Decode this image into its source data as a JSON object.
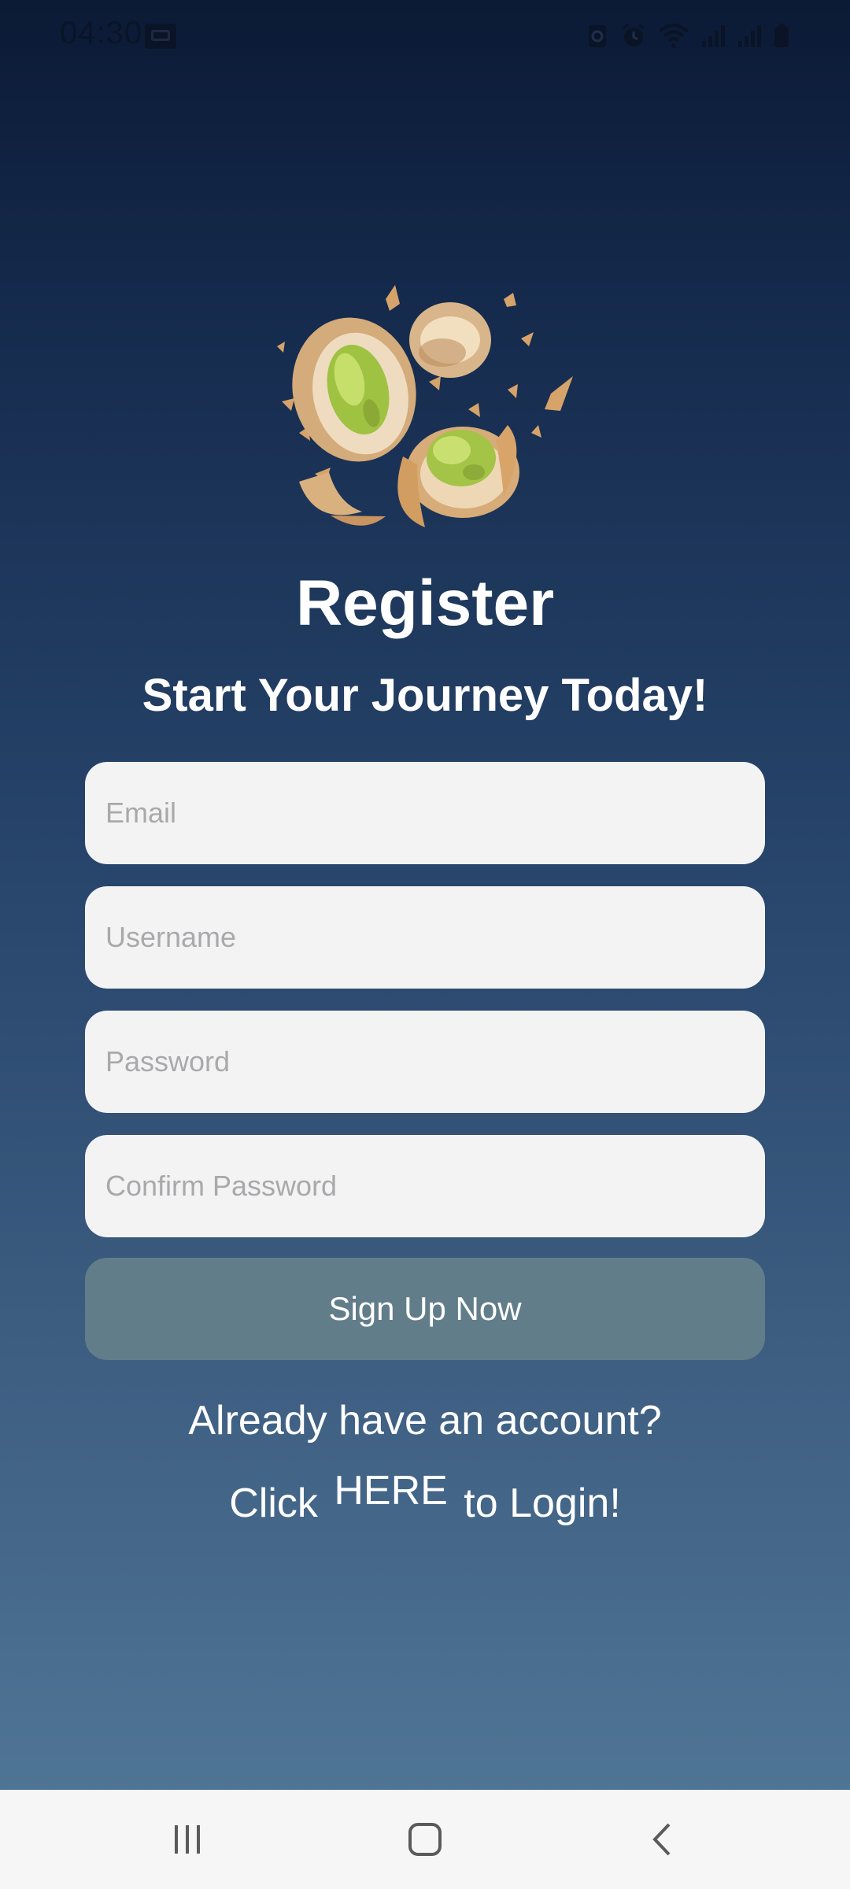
{
  "status_bar": {
    "time": "04:30"
  },
  "logo": {
    "icon": "pistachio-logo"
  },
  "title": "Register",
  "subtitle": "Start Your Journey Today!",
  "form": {
    "email_placeholder": "Email",
    "username_placeholder": "Username",
    "password_placeholder": "Password",
    "confirm_password_placeholder": "Confirm Password",
    "signup_label": "Sign Up Now"
  },
  "login_prompt": {
    "question": "Already have an account?",
    "prefix": "Click",
    "link": "HERE",
    "suffix": "to Login!"
  },
  "colors": {
    "background_top": "#0b1a35",
    "background_bottom": "#527897",
    "field_bg": "#f4f3f4",
    "button_bg": "#627d8a"
  }
}
